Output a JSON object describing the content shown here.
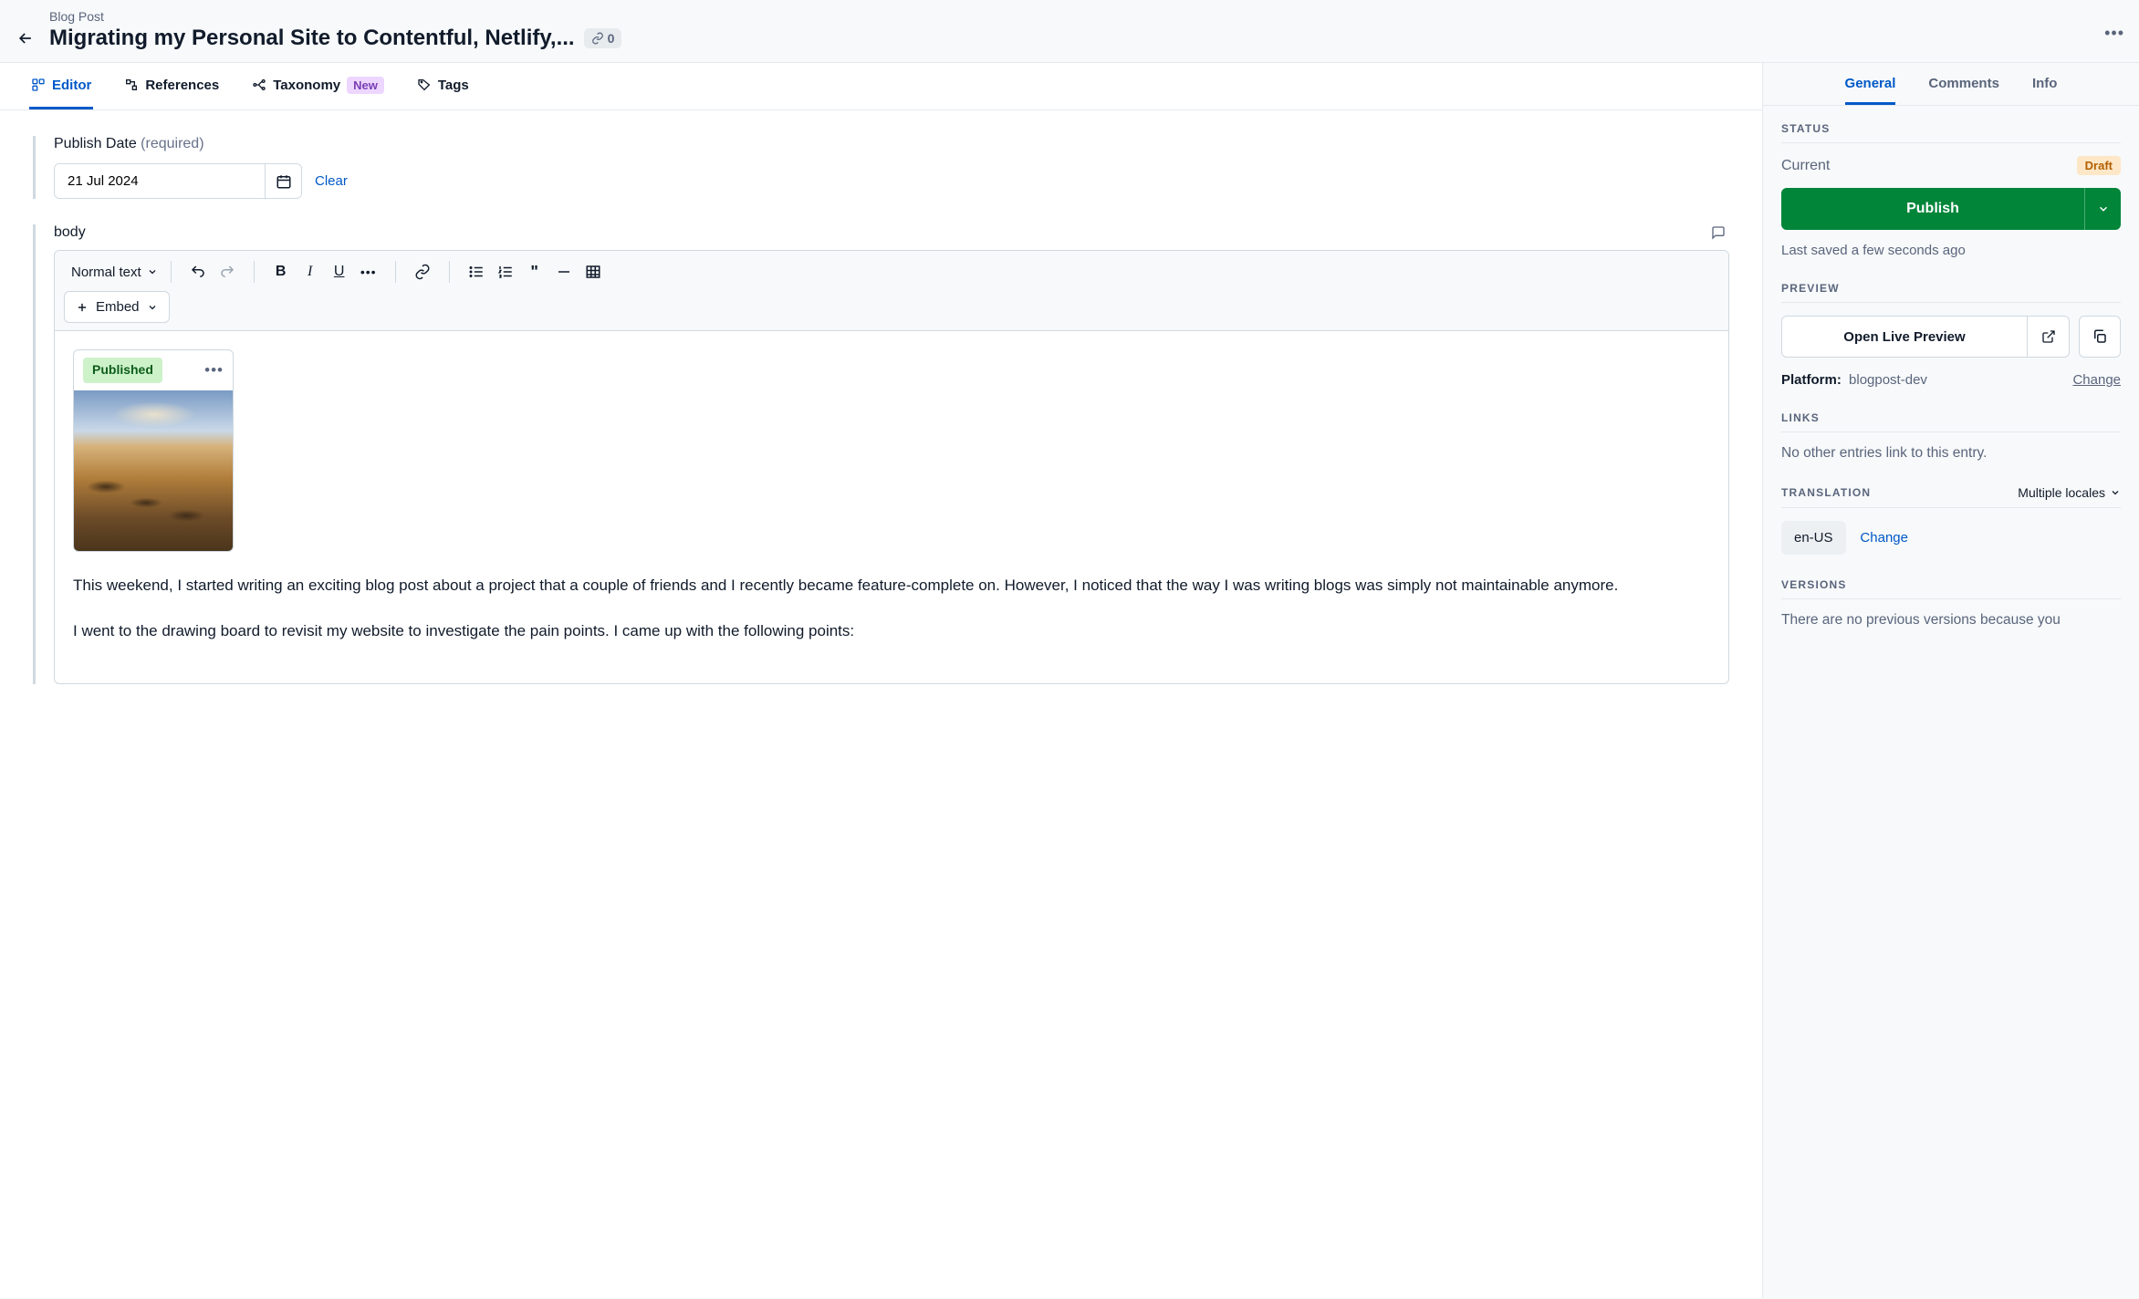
{
  "header": {
    "content_type": "Blog Post",
    "title": "Migrating my Personal Site to Contentful, Netlify,...",
    "link_count": "0"
  },
  "tabs": {
    "editor": "Editor",
    "references": "References",
    "taxonomy": "Taxonomy",
    "taxonomy_badge": "New",
    "tags": "Tags"
  },
  "fields": {
    "publish_date_label": "Publish Date",
    "publish_date_required": "(required)",
    "publish_date_value": "21 Jul 2024",
    "clear": "Clear",
    "body_label": "body"
  },
  "rte": {
    "text_style": "Normal text",
    "embed_label": "Embed",
    "asset_status": "Published",
    "para1": "This weekend, I started writing an exciting blog post about a project that a couple of friends and I recently became feature-complete on. However, I noticed that the way I was writing blogs was simply not maintainable anymore.",
    "para2": "I went to the drawing board to revisit my website to investigate the pain points. I came up with the following points:"
  },
  "sidebar": {
    "tabs": {
      "general": "General",
      "comments": "Comments",
      "info": "Info"
    },
    "status": {
      "heading": "STATUS",
      "current_label": "Current",
      "badge": "Draft",
      "publish_label": "Publish",
      "last_saved": "Last saved a few seconds ago"
    },
    "preview": {
      "heading": "PREVIEW",
      "open_label": "Open Live Preview",
      "platform_label": "Platform:",
      "platform_value": "blogpost-dev",
      "change": "Change"
    },
    "links": {
      "heading": "LINKS",
      "text": "No other entries link to this entry."
    },
    "translation": {
      "heading": "TRANSLATION",
      "selector": "Multiple locales",
      "locale": "en-US",
      "change": "Change"
    },
    "versions": {
      "heading": "VERSIONS",
      "text": "There are no previous versions because you"
    }
  }
}
